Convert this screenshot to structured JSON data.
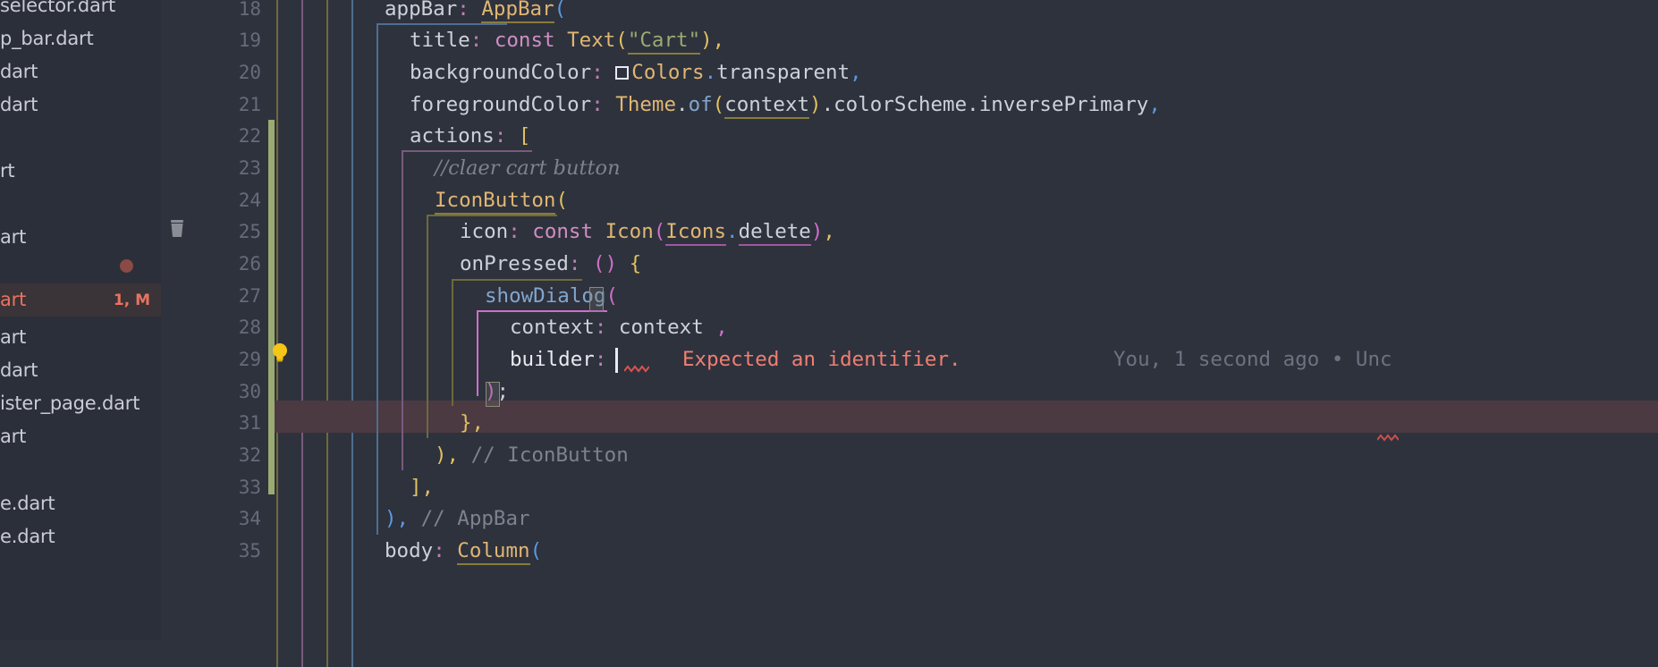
{
  "window": {
    "theme": "dark",
    "colors": {
      "editor_bg": "#2e323d",
      "sidebar_bg": "#2b2f39",
      "selection_bg": "#3a3337",
      "accent_red": "#e8735f",
      "error_line_bg": "#4b3a42",
      "change_bar_green": "#9aaa72",
      "line_number": "#656b7a",
      "string_green": "#9aaa72",
      "keyword_pink": "#cf8ec4",
      "type_orange": "#e0b673",
      "function_blue": "#83a5cc",
      "comment_gray": "#7d828f"
    }
  },
  "sidebar": {
    "name": "project-file-tree",
    "items": [
      {
        "label": "selector.dart",
        "selected": false,
        "meta": ""
      },
      {
        "label": "p_bar.dart",
        "selected": false,
        "meta": ""
      },
      {
        "label": "dart",
        "selected": false,
        "meta": ""
      },
      {
        "label": "dart",
        "selected": false,
        "meta": ""
      },
      {
        "label": "rt",
        "selected": false,
        "meta": ""
      },
      {
        "label": "art",
        "selected": false,
        "meta": ""
      },
      {
        "label": "art",
        "selected": true,
        "meta": "1, M"
      },
      {
        "label": "art",
        "selected": false,
        "meta": ""
      },
      {
        "label": "dart",
        "selected": false,
        "meta": ""
      },
      {
        "label": "ister_page.dart",
        "selected": false,
        "meta": ""
      },
      {
        "label": "art",
        "selected": false,
        "meta": ""
      },
      {
        "label": "e.dart",
        "selected": false,
        "meta": ""
      },
      {
        "label": "e.dart",
        "selected": false,
        "meta": ""
      }
    ],
    "error_marker": "error-dot"
  },
  "gutter": {
    "name": "line-number-gutter",
    "line_numbers": [
      18,
      19,
      20,
      21,
      22,
      23,
      24,
      25,
      26,
      27,
      28,
      29,
      30,
      31,
      32,
      33,
      34,
      35
    ],
    "icons": [
      {
        "name": "delete-gutter-icon",
        "glyph": "trash",
        "line": 25
      },
      {
        "name": "intention-bulb-icon",
        "glyph": "lightbulb",
        "line": 29
      }
    ]
  },
  "editor": {
    "name": "code-editor",
    "language": "dart",
    "caret_line": 29,
    "lines": [
      {
        "n": 18,
        "text": "      appBar: AppBar("
      },
      {
        "n": 19,
        "text": "        title: const Text(\"Cart\"),"
      },
      {
        "n": 20,
        "text": "        backgroundColor: □Colors.transparent,"
      },
      {
        "n": 21,
        "text": "        foregroundColor: Theme.of(context).colorScheme.inversePrimary,"
      },
      {
        "n": 22,
        "text": "        actions: ["
      },
      {
        "n": 23,
        "text": "          //claer cart button"
      },
      {
        "n": 24,
        "text": "          IconButton("
      },
      {
        "n": 25,
        "text": "            icon: const Icon(Icons.delete),"
      },
      {
        "n": 26,
        "text": "            onPressed: () {"
      },
      {
        "n": 27,
        "text": "              showDialog("
      },
      {
        "n": 28,
        "text": "                context: context ,"
      },
      {
        "n": 29,
        "text": "                builder: "
      },
      {
        "n": 30,
        "text": "              );"
      },
      {
        "n": 31,
        "text": "            },"
      },
      {
        "n": 32,
        "text": "          ), // IconButton"
      },
      {
        "n": 33,
        "text": "        ],"
      },
      {
        "n": 34,
        "text": "      ), // AppBar"
      },
      {
        "n": 35,
        "text": "      body: Column("
      }
    ],
    "inline_hints": {
      "error_message": "Expected an identifier.",
      "blame_annotation": "You, 1 second ago • Unc"
    }
  },
  "tokens": {
    "l18": {
      "key": "appBar",
      "colon": ":",
      "type": "AppBar",
      "paren": "("
    },
    "l19": {
      "key": "title",
      "const": "const",
      "type": "Text",
      "string": "\"Cart\""
    },
    "l20": {
      "key": "backgroundColor",
      "type": "Colors",
      "member": ".transparent,"
    },
    "l21": {
      "key": "foregroundColor",
      "type": "Theme",
      "fn": "of",
      "arg": "context",
      "member": ".colorScheme.inversePrimary,"
    },
    "l22": {
      "key": "actions",
      "bracket": "["
    },
    "l23": {
      "comment": "//claer cart button"
    },
    "l24": {
      "type": "IconButton",
      "paren": "("
    },
    "l25": {
      "key": "icon",
      "const": "const",
      "type": "Icon",
      "arg": "Icons",
      "member": ".delete"
    },
    "l26": {
      "key": "onPressed",
      "paren": "()",
      "brace": "{"
    },
    "l27": {
      "fn": "showDialog",
      "paren": "("
    },
    "l28": {
      "key": "context",
      "value": "context"
    },
    "l29": {
      "key": "builder"
    },
    "l32": {
      "comment": "// IconButton"
    },
    "l34": {
      "comment": "// AppBar"
    },
    "l35": {
      "key": "body",
      "type": "Column",
      "paren": "("
    }
  }
}
